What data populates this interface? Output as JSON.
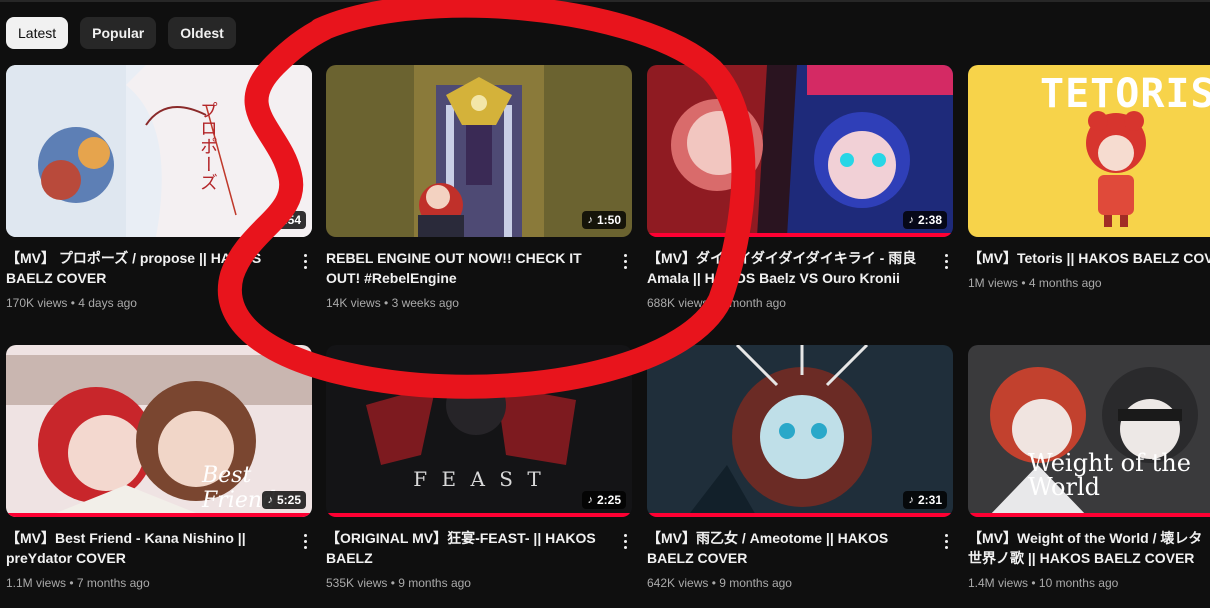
{
  "filter_chips": [
    {
      "label": "Latest",
      "active": true
    },
    {
      "label": "Popular",
      "active": false
    },
    {
      "label": "Oldest",
      "active": false
    }
  ],
  "videos": [
    {
      "title": "【MV】 プロポーズ / propose || HAKOS BAELZ COVER",
      "views": "170K views",
      "age": "4 days ago",
      "duration": "3:54",
      "music_badge": false,
      "thumb_text": "プロポーズ"
    },
    {
      "title": "REBEL ENGINE OUT NOW!! CHECK IT OUT! #RebelEngine",
      "views": "14K views",
      "age": "3 weeks ago",
      "duration": "1:50",
      "music_badge": true,
      "thumb_text": ""
    },
    {
      "title": "【MV】ダイダイダイダイダイキライ - 雨良 Amala || HAKOS Baelz VS Ouro Kronii COVER",
      "views": "688K views",
      "age": "1 month ago",
      "duration": "2:38",
      "music_badge": true,
      "thumb_text": ""
    },
    {
      "title": "【MV】Tetoris || HAKOS BAELZ COVER",
      "views": "1M views",
      "age": "4 months ago",
      "duration": "",
      "music_badge": false,
      "thumb_text": "TETORIS"
    },
    {
      "title": "【MV】Best Friend - Kana Nishino || preYdator COVER",
      "views": "1.1M views",
      "age": "7 months ago",
      "duration": "5:25",
      "music_badge": true,
      "thumb_text": "Best Friend"
    },
    {
      "title": "【ORIGINAL MV】狂宴-FEAST- || HAKOS BAELZ",
      "views": "535K views",
      "age": "9 months ago",
      "duration": "2:25",
      "music_badge": true,
      "thumb_text": "F E A S T"
    },
    {
      "title": "【MV】雨乙女 / Ameotome || HAKOS BAELZ COVER",
      "views": "642K views",
      "age": "9 months ago",
      "duration": "2:31",
      "music_badge": true,
      "thumb_text": ""
    },
    {
      "title": "【MV】Weight of the World / 壊レタ世界ノ歌 || HAKOS BAELZ COVER",
      "views": "1.4M views",
      "age": "10 months ago",
      "duration": "",
      "music_badge": false,
      "thumb_text": "Weight of the World"
    }
  ],
  "colors": {
    "background": "#0f0f0f",
    "chip_bg": "#272727",
    "progress_red": "#ff0033",
    "annotation_red": "#e8141c"
  }
}
